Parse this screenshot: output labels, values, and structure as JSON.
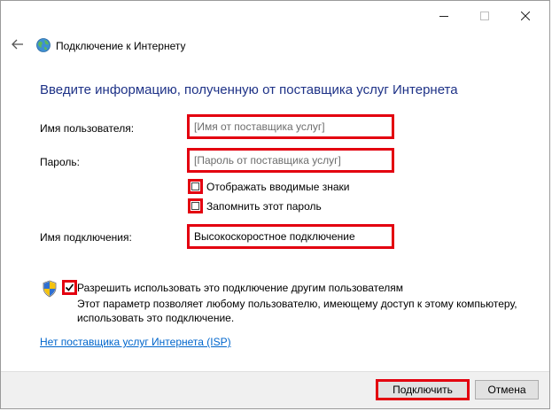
{
  "window": {
    "nav_title": "Подключение к Интернету"
  },
  "titlebar": {
    "minimize_icon": "minimize-icon",
    "maximize_icon": "maximize-icon",
    "close_icon": "close-icon"
  },
  "heading": "Введите информацию, полученную от поставщика услуг Интернета",
  "form": {
    "username_label": "Имя пользователя:",
    "username_placeholder": "[Имя от поставщика услуг]",
    "password_label": "Пароль:",
    "password_placeholder": "[Пароль от поставщика услуг]",
    "show_chars_label": "Отображать вводимые знаки",
    "show_chars_checked": false,
    "remember_label": "Запомнить этот пароль",
    "remember_checked": false,
    "connection_name_label": "Имя подключения:",
    "connection_name_value": "Высокоскоростное подключение"
  },
  "share": {
    "label": "Разрешить использовать это подключение другим пользователям",
    "checked": true,
    "description": "Этот параметр позволяет любому пользователю, имеющему доступ к этому компьютеру, использовать это подключение."
  },
  "isp_link": "Нет поставщика услуг Интернета (ISP)",
  "footer": {
    "connect_label": "Подключить",
    "cancel_label": "Отмена"
  },
  "colors": {
    "highlight": "#e3000f",
    "heading": "#1e3287",
    "link": "#0066cc"
  }
}
